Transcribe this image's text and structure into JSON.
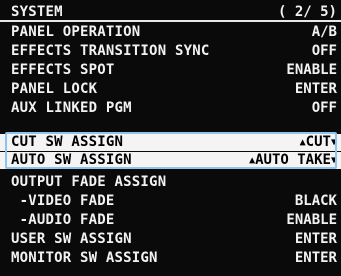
{
  "menu": {
    "title": "SYSTEM",
    "page": "( 2/ 5)",
    "rows": [
      {
        "label": "PANEL OPERATION",
        "value": "A/B"
      },
      {
        "label": "EFFECTS TRANSITION SYNC",
        "value": "OFF"
      },
      {
        "label": "EFFECTS SPOT",
        "value": "ENABLE"
      },
      {
        "label": "PANEL LOCK",
        "value": "ENTER"
      },
      {
        "label": "AUX LINKED PGM",
        "value": "OFF"
      },
      {
        "label": "CUT SW ASSIGN",
        "value": "CUT"
      },
      {
        "label": "AUTO SW ASSIGN",
        "value": "AUTO TAKE"
      },
      {
        "label": "OUTPUT FADE ASSIGN",
        "value": ""
      },
      {
        "label": " -VIDEO FADE",
        "value": "BLACK"
      },
      {
        "label": " -AUDIO FADE",
        "value": "ENABLE"
      },
      {
        "label": "USER SW ASSIGN",
        "value": "ENTER"
      },
      {
        "label": "MONITOR SW ASSIGN",
        "value": "ENTER"
      }
    ]
  },
  "arrows": {
    "left": "▲",
    "right": "▼"
  },
  "colors": {
    "background": "#0a0a0a",
    "text": "#f2f2f2",
    "highlight": "#f4f4f4",
    "frame": "#8fc3ef"
  }
}
